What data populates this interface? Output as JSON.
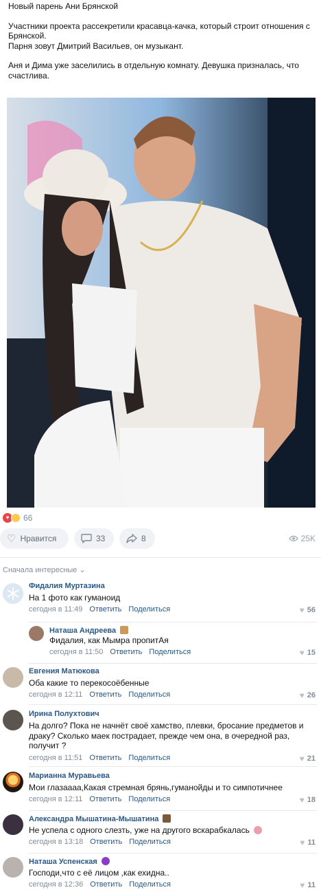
{
  "post": {
    "title": "Новый парень Ани Брянской",
    "p1": "Участники проекта рассекретили красавца-качка, который строит отношения с Брянской.",
    "p2": "Парня зовут Дмитрий Васильев, он музыкант.",
    "p3": "Аня и Дима уже заселились в отдельную комнату. Девушка призналась, что счастлива."
  },
  "reactions": {
    "count": "66"
  },
  "actions": {
    "like_label": "Нравится",
    "comments": "33",
    "shares": "8",
    "views": "25K"
  },
  "sort_label": "Сначала интересные",
  "labels": {
    "reply": "Ответить",
    "share": "Поделиться"
  },
  "comments": [
    {
      "author": "Фидалия Муртазина",
      "text": "На 1 фото как гуманоид",
      "time": "сегодня в 11:49",
      "likes": "56"
    },
    {
      "author": "Наташа Андреева",
      "text": "Фидалия, как Мымра пропитАя",
      "time": "сегодня в 11:50",
      "likes": "15"
    },
    {
      "author": "Евгения Матюкова",
      "text": "Оба какие то перекосоёбенные",
      "time": "сегодня в 12:11",
      "likes": "26"
    },
    {
      "author": "Ирина Полухтович",
      "text": "На долго? Пока не начнёт своё хамство, плевки, бросание предметов и драку? Сколько маек пострадает, прежде чем она, в очередной раз, получит ?",
      "time": "сегодня в 11:51",
      "likes": "21"
    },
    {
      "author": "Марианна Муравьева",
      "text": "Мои глазаааа,Какая стремная брянь,гуманойды и то симпотичнее",
      "time": "сегодня в 12:11",
      "likes": "18"
    },
    {
      "author": "Александра Мышатина-Мышатина",
      "text": "Не успела с одного слезть, уже на другого вскарабкалась",
      "time": "сегодня в 13:18",
      "likes": "11"
    },
    {
      "author": "Наташа Успенская",
      "text": "Господи,что с её лицом ,как ехидна..",
      "time": "сегодня в 12:36",
      "likes": "11"
    }
  ],
  "colors": {
    "link": "#2a5885",
    "muted": "#818c99",
    "pill": "#f0f2f5"
  }
}
